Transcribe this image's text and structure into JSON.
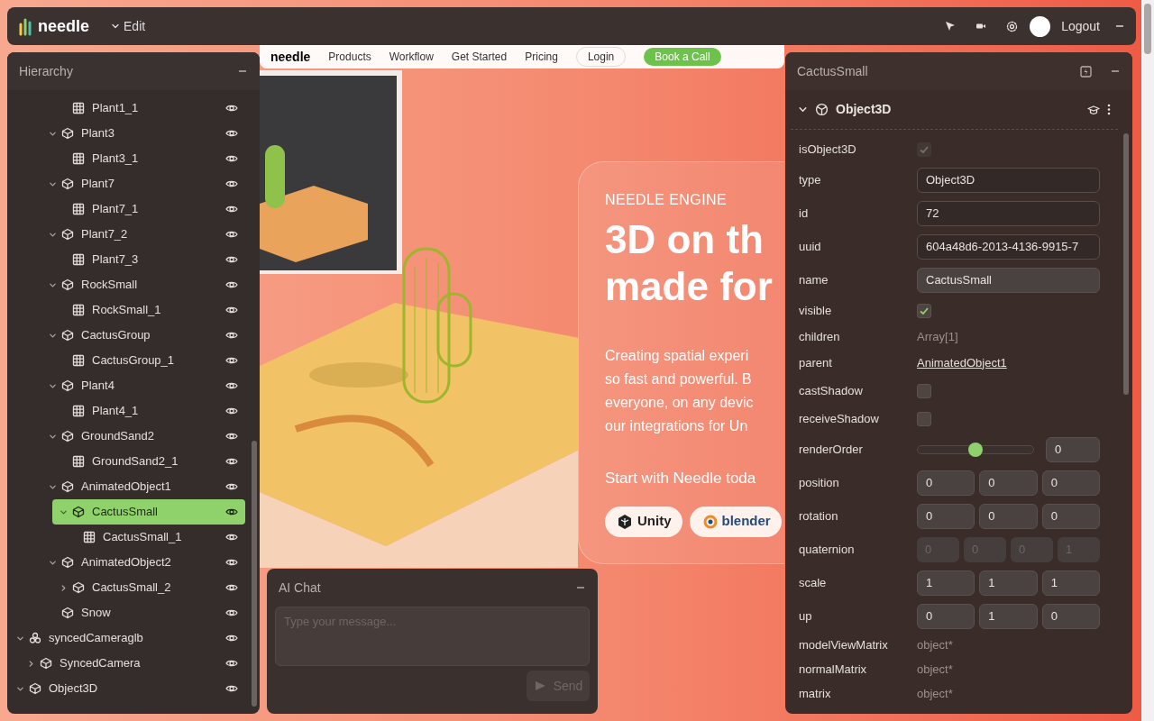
{
  "toolbar": {
    "brand": "needle",
    "menu": "Edit",
    "logout": "Logout"
  },
  "website": {
    "nav": [
      "needle",
      "Products",
      "Workflow",
      "Get Started",
      "Pricing"
    ],
    "login": "Login",
    "cta": "Book a Call",
    "hero": {
      "eyebrow": "NEEDLE ENGINE",
      "headline": [
        "3D on th",
        "made for"
      ],
      "body": [
        "Creating spatial experi",
        "so fast and powerful. B",
        "everyone, on any devic",
        "our integrations for Un"
      ],
      "start": "Start with Needle toda",
      "buttons": [
        "Unity",
        "blender"
      ]
    }
  },
  "hierarchy": {
    "title": "Hierarchy",
    "items": [
      {
        "children": [
          {
            "children": [
              {
                "children": [
                  {
                    "children": [
                      {
                        "name": "Plant1_1",
                        "kind": "mesh",
                        "selected": false
                      }
                    ]
                  },
                  {
                    "name": "Plant3",
                    "kind": "object",
                    "expanded": true,
                    "selected": false,
                    "children": [
                      {
                        "name": "Plant3_1",
                        "kind": "mesh",
                        "selected": false
                      }
                    ]
                  },
                  {
                    "name": "Plant7",
                    "kind": "object",
                    "expanded": true,
                    "selected": false,
                    "children": [
                      {
                        "name": "Plant7_1",
                        "kind": "mesh",
                        "selected": false
                      }
                    ]
                  },
                  {
                    "name": "Plant7_2",
                    "kind": "object",
                    "expanded": true,
                    "selected": false,
                    "children": [
                      {
                        "name": "Plant7_3",
                        "kind": "mesh",
                        "selected": false
                      }
                    ]
                  },
                  {
                    "name": "RockSmall",
                    "kind": "object",
                    "expanded": true,
                    "selected": false,
                    "children": [
                      {
                        "name": "RockSmall_1",
                        "kind": "mesh",
                        "selected": false
                      }
                    ]
                  },
                  {
                    "name": "CactusGroup",
                    "kind": "object",
                    "expanded": true,
                    "selected": false,
                    "children": [
                      {
                        "name": "CactusGroup_1",
                        "kind": "mesh",
                        "selected": false
                      }
                    ]
                  },
                  {
                    "name": "Plant4",
                    "kind": "object",
                    "expanded": true,
                    "selected": false,
                    "children": [
                      {
                        "name": "Plant4_1",
                        "kind": "mesh",
                        "selected": false
                      }
                    ]
                  },
                  {
                    "name": "GroundSand2",
                    "kind": "object",
                    "expanded": true,
                    "selected": false,
                    "children": [
                      {
                        "name": "GroundSand2_1",
                        "kind": "mesh",
                        "selected": false
                      }
                    ]
                  },
                  {
                    "name": "AnimatedObject1",
                    "kind": "object",
                    "expanded": true,
                    "selected": false,
                    "children": [
                      {
                        "name": "CactusSmall",
                        "kind": "object",
                        "expanded": true,
                        "selected": true,
                        "children": [
                          {
                            "name": "CactusSmall_1",
                            "kind": "mesh",
                            "selected": false
                          }
                        ]
                      }
                    ]
                  },
                  {
                    "name": "AnimatedObject2",
                    "kind": "object",
                    "expanded": true,
                    "selected": false,
                    "children": [
                      {
                        "name": "CactusSmall_2",
                        "kind": "object",
                        "expanded": false,
                        "selected": false
                      }
                    ]
                  },
                  {
                    "name": "Snow",
                    "kind": "object",
                    "selected": false
                  }
                ]
              }
            ]
          }
        ]
      },
      {
        "name": "syncedCameraglb",
        "kind": "group",
        "expanded": true,
        "selected": false,
        "children": [
          {
            "name": "SyncedCamera",
            "kind": "object",
            "expanded": false,
            "selected": false
          }
        ]
      },
      {
        "name": "Object3D",
        "kind": "object",
        "expanded": true,
        "selected": false
      }
    ]
  },
  "inspector": {
    "title": "CactusSmall",
    "component": {
      "name": "Object3D",
      "expanded": true
    },
    "properties": [
      {
        "label": "isObject3D",
        "kind": "checkbox",
        "checked": true,
        "disabled": true
      },
      {
        "label": "type",
        "kind": "field",
        "value": "Object3D",
        "editable": false
      },
      {
        "label": "id",
        "kind": "field",
        "value": "72",
        "editable": false
      },
      {
        "label": "uuid",
        "kind": "field",
        "value": "604a48d6-2013-4136-9915-7",
        "editable": false
      },
      {
        "label": "name",
        "kind": "field",
        "value": "CactusSmall",
        "editable": true
      },
      {
        "label": "visible",
        "kind": "checkbox",
        "checked": true,
        "disabled": false
      },
      {
        "label": "children",
        "kind": "text",
        "value": "Array[1]"
      },
      {
        "label": "parent",
        "kind": "link",
        "value": "AnimatedObject1"
      },
      {
        "label": "castShadow",
        "kind": "checkbox",
        "checked": false,
        "disabled": false
      },
      {
        "label": "receiveShadow",
        "kind": "checkbox",
        "checked": false,
        "disabled": false
      },
      {
        "label": "renderOrder",
        "kind": "slider",
        "level": 0.5,
        "value": "0"
      },
      {
        "label": "position",
        "kind": "vector",
        "values": [
          "0",
          "0",
          "0"
        ],
        "disabled": false
      },
      {
        "label": "rotation",
        "kind": "vector",
        "values": [
          "0",
          "0",
          "0"
        ],
        "disabled": false
      },
      {
        "label": "quaternion",
        "kind": "vector",
        "values": [
          "0",
          "0",
          "0",
          "1"
        ],
        "disabled": true
      },
      {
        "label": "scale",
        "kind": "vector",
        "values": [
          "1",
          "1",
          "1"
        ],
        "disabled": false
      },
      {
        "label": "up",
        "kind": "vector",
        "values": [
          "0",
          "1",
          "0"
        ],
        "disabled": false
      },
      {
        "label": "modelViewMatrix",
        "kind": "text",
        "value": "object*"
      },
      {
        "label": "normalMatrix",
        "kind": "text",
        "value": "object*"
      },
      {
        "label": "matrix",
        "kind": "text",
        "value": "object*"
      }
    ]
  },
  "chat": {
    "title": "AI Chat",
    "placeholder": "Type your message...",
    "send": "Send",
    "send_disabled": true
  }
}
